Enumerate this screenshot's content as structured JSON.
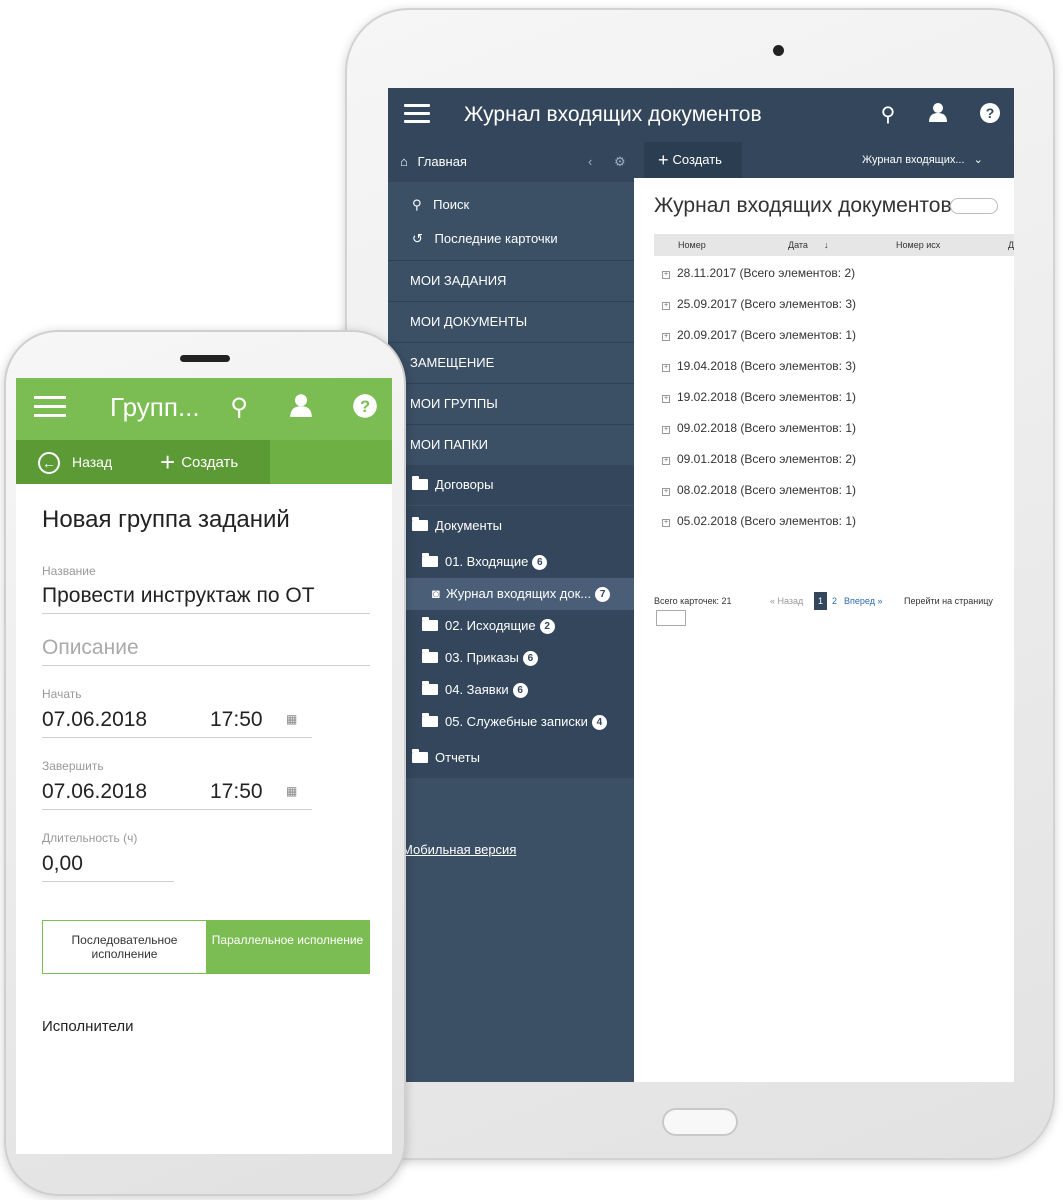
{
  "tablet": {
    "title": "Журнал входящих документов",
    "icons": {
      "menu": "hamburger-icon",
      "search": "search-icon",
      "user": "user-icon",
      "help": "help-icon"
    },
    "sidebar": {
      "home": "Главная",
      "search": "Поиск",
      "recent": "Последние карточки",
      "sections": [
        "МОИ ЗАДАНИЯ",
        "МОИ ДОКУМЕНТЫ",
        "ЗАМЕЩЕНИЕ",
        "МОИ ГРУППЫ",
        "МОИ ПАПКИ"
      ],
      "contracts": "Договоры",
      "documents": "Документы",
      "incoming": {
        "label": "01. Входящие",
        "count": "6"
      },
      "journal": {
        "label": "Журнал входящих док...",
        "count": "7"
      },
      "outgoing": {
        "label": "02. Исходящие",
        "count": "2"
      },
      "orders": {
        "label": "03. Приказы",
        "count": "6"
      },
      "requests": {
        "label": "04. Заявки",
        "count": "6"
      },
      "memos": {
        "label": "05. Служебные записки",
        "count": "4"
      },
      "reports": "Отчеты",
      "mobile": "Мобильная версия"
    },
    "toolbar": {
      "create": "Создать",
      "journal_dropdown": "Журнал входящих..."
    },
    "content": {
      "heading": "Журнал входящих документов",
      "columns": [
        "Номер",
        "Дата",
        "Номер исх",
        "Д"
      ],
      "groups": [
        "28.11.2017 (Всего элементов: 2)",
        "25.09.2017 (Всего элементов: 3)",
        "20.09.2017 (Всего элементов: 1)",
        "19.04.2018 (Всего элементов: 3)",
        "19.02.2018 (Всего элементов: 1)",
        "09.02.2018 (Всего элементов: 1)",
        "09.01.2018 (Всего элементов: 2)",
        "08.02.2018 (Всего элементов: 1)",
        "05.02.2018 (Всего элементов: 1)"
      ],
      "pager": {
        "total": "Всего карточек: 21",
        "prev": "« Назад",
        "page1": "1",
        "page2": "2",
        "next": "Вперед »",
        "goto": "Перейти на страницу"
      }
    }
  },
  "phone": {
    "header_title": "Групп...",
    "icons": {
      "menu": "hamburger-icon",
      "search": "search-icon",
      "user": "user-icon",
      "help": "help-icon"
    },
    "toolbar": {
      "back": "Назад",
      "create": "Создать"
    },
    "form": {
      "heading": "Новая группа заданий",
      "name_label": "Название",
      "name_value": "Провести инструктаж по ОТ",
      "description_placeholder": "Описание",
      "start_label": "Начать",
      "start_date": "07.06.2018",
      "start_time": "17:50",
      "end_label": "Завершить",
      "end_date": "07.06.2018",
      "end_time": "17:50",
      "duration_label": "Длительность (ч)",
      "duration_value": "0,00",
      "mode_sequential": "Последовательное исполнение",
      "mode_parallel": "Параллельное исполнение",
      "executors": "Исполнители"
    }
  },
  "colors": {
    "tablet_dark": "#33465b",
    "tablet_sidebar": "#3b4f65",
    "phone_green": "#7bbd52",
    "phone_green_dark": "#5c9a36"
  }
}
